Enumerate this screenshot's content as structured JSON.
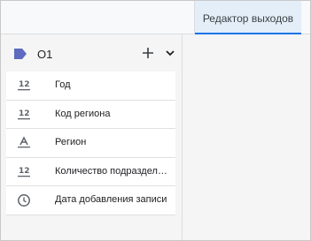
{
  "tabs": [
    {
      "label": "Редактор выходов",
      "active": true
    }
  ],
  "group": {
    "name": "O1",
    "tag_color": "#5c6bc0"
  },
  "fields": [
    {
      "type_icon": "number-type-icon",
      "type_text": "12",
      "label": "Год"
    },
    {
      "type_icon": "number-type-icon",
      "type_text": "12",
      "label": "Код региона"
    },
    {
      "type_icon": "text-type-icon",
      "type_text": "A",
      "label": "Регион"
    },
    {
      "type_icon": "number-type-icon",
      "type_text": "12",
      "label": "Количество подразделений"
    },
    {
      "type_icon": "datetime-type-icon",
      "type_text": "",
      "label": "Дата добавления записи"
    }
  ],
  "colors": {
    "accent": "#1a73e8",
    "active_tab_bg": "#e3eef9",
    "panel_bg": "#f5f5f5"
  }
}
